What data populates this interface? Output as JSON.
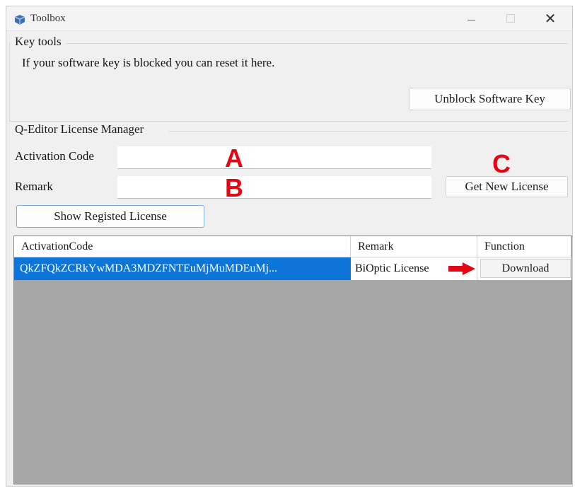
{
  "window": {
    "title": "Toolbox",
    "controls": {
      "minimize": "minimize",
      "maximize": "maximize",
      "close": "✕"
    }
  },
  "key_tools": {
    "group_label": "Key tools",
    "description": "If your software key is blocked you can reset it here.",
    "unblock_button": "Unblock Software Key"
  },
  "license_manager": {
    "group_label": "Q-Editor License Manager",
    "activation_code_label": "Activation Code",
    "activation_code_value": "",
    "remark_label": "Remark",
    "remark_value": "",
    "get_new_license_button": "Get New License",
    "show_registered_button": "Show Registed License"
  },
  "annotations": {
    "marker_a": "A",
    "marker_b": "B",
    "marker_c": "C",
    "color": "#e30613"
  },
  "license_table": {
    "columns": [
      "ActivationCode",
      "Remark",
      "Function"
    ],
    "rows": [
      {
        "activation_code": "QkZFQkZCRkYwMDA3MDZFNTEuMjMuMDEuMj...",
        "remark": "BiOptic License",
        "function": "Download",
        "selected": true
      }
    ]
  },
  "colors": {
    "selection": "#0d74d8",
    "grid_background": "#a7a7a7",
    "window_background": "#f0f0f0"
  }
}
